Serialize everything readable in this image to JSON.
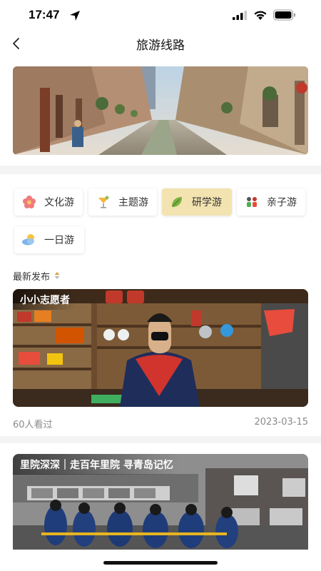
{
  "status_bar": {
    "time": "17:47",
    "icons": [
      "location-arrow-icon",
      "cellular-signal-icon",
      "wifi-icon",
      "battery-icon"
    ]
  },
  "nav": {
    "title": "旅游线路",
    "back_icon": "chevron-left-icon"
  },
  "banner": {
    "description_icon": "street-scene-photo"
  },
  "categories": [
    {
      "label": "文化游",
      "icon": "flower-icon",
      "active": false
    },
    {
      "label": "主题游",
      "icon": "cocktail-icon",
      "active": false
    },
    {
      "label": "研学游",
      "icon": "leaf-icon",
      "active": true
    },
    {
      "label": "亲子游",
      "icon": "family-icon",
      "active": false
    },
    {
      "label": "一日游",
      "icon": "cloud-sun-icon",
      "active": false
    }
  ],
  "sort": {
    "label": "最新发布",
    "icon": "sort-icon"
  },
  "cards": [
    {
      "title": "小小志愿者",
      "views": "60人看过",
      "date": "2023-03-15"
    },
    {
      "title": "里院深深｜走百年里院 寻青岛记忆"
    }
  ],
  "colors": {
    "active_tag": "#f3e3b0",
    "meta_text": "#8a8a8a",
    "band": "#f4f4f4"
  }
}
